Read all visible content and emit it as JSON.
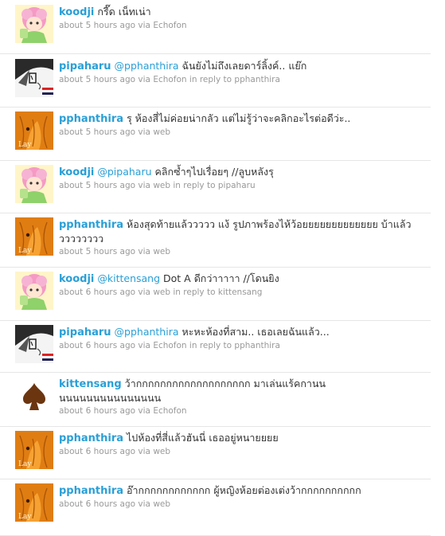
{
  "tweets": [
    {
      "avatar": "pink-haired-girl-avatar",
      "user": "koodji",
      "mention": "",
      "text": "กรี๊ด เน็ทเน่า",
      "time": "about 5 hours ago",
      "via": "via",
      "source": "Echofon",
      "reply_prefix": "",
      "reply_to": ""
    },
    {
      "avatar": "sketch-face-avatar",
      "user": "pipaharu",
      "mention": "@pphanthira",
      "text": "ฉันยังไม่ถึงเลยดาร์ลิ้งค์.. แย๊ก",
      "time": "about 5 hours ago",
      "via": "via",
      "source": "Echofon",
      "reply_prefix": "in reply to",
      "reply_to": "pphanthira"
    },
    {
      "avatar": "orange-hair-girl-avatar",
      "user": "pphanthira",
      "mention": "",
      "text": "รุ ห้องสี่ไม่ค่อยน่ากลัว แต่ไม่รู้ว่าจะคลิกอะไรต่อดีว่ะ..",
      "time": "about 5 hours ago",
      "via": "via",
      "source": "web",
      "reply_prefix": "",
      "reply_to": ""
    },
    {
      "avatar": "pink-haired-girl-avatar",
      "user": "koodji",
      "mention": "@pipaharu",
      "text": "คลิกซ้ำๆไปเรื่อยๆ //ลูบหลังรุ",
      "time": "about 5 hours ago",
      "via": "via",
      "source": "web",
      "reply_prefix": "in reply to",
      "reply_to": "pipaharu"
    },
    {
      "avatar": "orange-hair-girl-avatar",
      "user": "pphanthira",
      "mention": "",
      "text": "ห้องสุดท้ายแล้ววววว แง้ รูปภาพร้องไห้ว้อยยยยยยยยยยยยย บ้าแล้ววววววววว",
      "time": "about 5 hours ago",
      "via": "via",
      "source": "web",
      "reply_prefix": "",
      "reply_to": ""
    },
    {
      "avatar": "pink-haired-girl-avatar",
      "user": "koodji",
      "mention": "@kittensang",
      "text": "Dot A ดีกว่าาาาา //โดนยิง",
      "time": "about 6 hours ago",
      "via": "via",
      "source": "web",
      "reply_prefix": "in reply to",
      "reply_to": "kittensang"
    },
    {
      "avatar": "sketch-face-avatar",
      "user": "pipaharu",
      "mention": "@pphanthira",
      "text": "หะหะห้องที่สาม.. เธอเลยฉันแล้ว...",
      "time": "about 6 hours ago",
      "via": "via",
      "source": "Echofon",
      "reply_prefix": "in reply to",
      "reply_to": "pphanthira"
    },
    {
      "avatar": "spade-avatar",
      "user": "kittensang",
      "mention": "",
      "text": "ว้ากกกกกกกกกกกกกกกกกกก มาเล่นแร้คกานน นนนนนนนนนนนนนนน",
      "time": "about 6 hours ago",
      "via": "via",
      "source": "Echofon",
      "reply_prefix": "",
      "reply_to": ""
    },
    {
      "avatar": "orange-hair-girl-avatar",
      "user": "pphanthira",
      "mention": "",
      "text": "ไปห้องที่สี่แล้วฮันนี่ เธออยู่หนายยยย",
      "time": "about 6 hours ago",
      "via": "via",
      "source": "web",
      "reply_prefix": "",
      "reply_to": ""
    },
    {
      "avatar": "orange-hair-girl-avatar",
      "user": "pphanthira",
      "mention": "",
      "text": "อ๊ากกกกกกกกกกกก ผู้หญิงห้อยต่องเต่งว้ากกกกกกกกกก",
      "time": "about 6 hours ago",
      "via": "via",
      "source": "web",
      "reply_prefix": "",
      "reply_to": ""
    }
  ]
}
